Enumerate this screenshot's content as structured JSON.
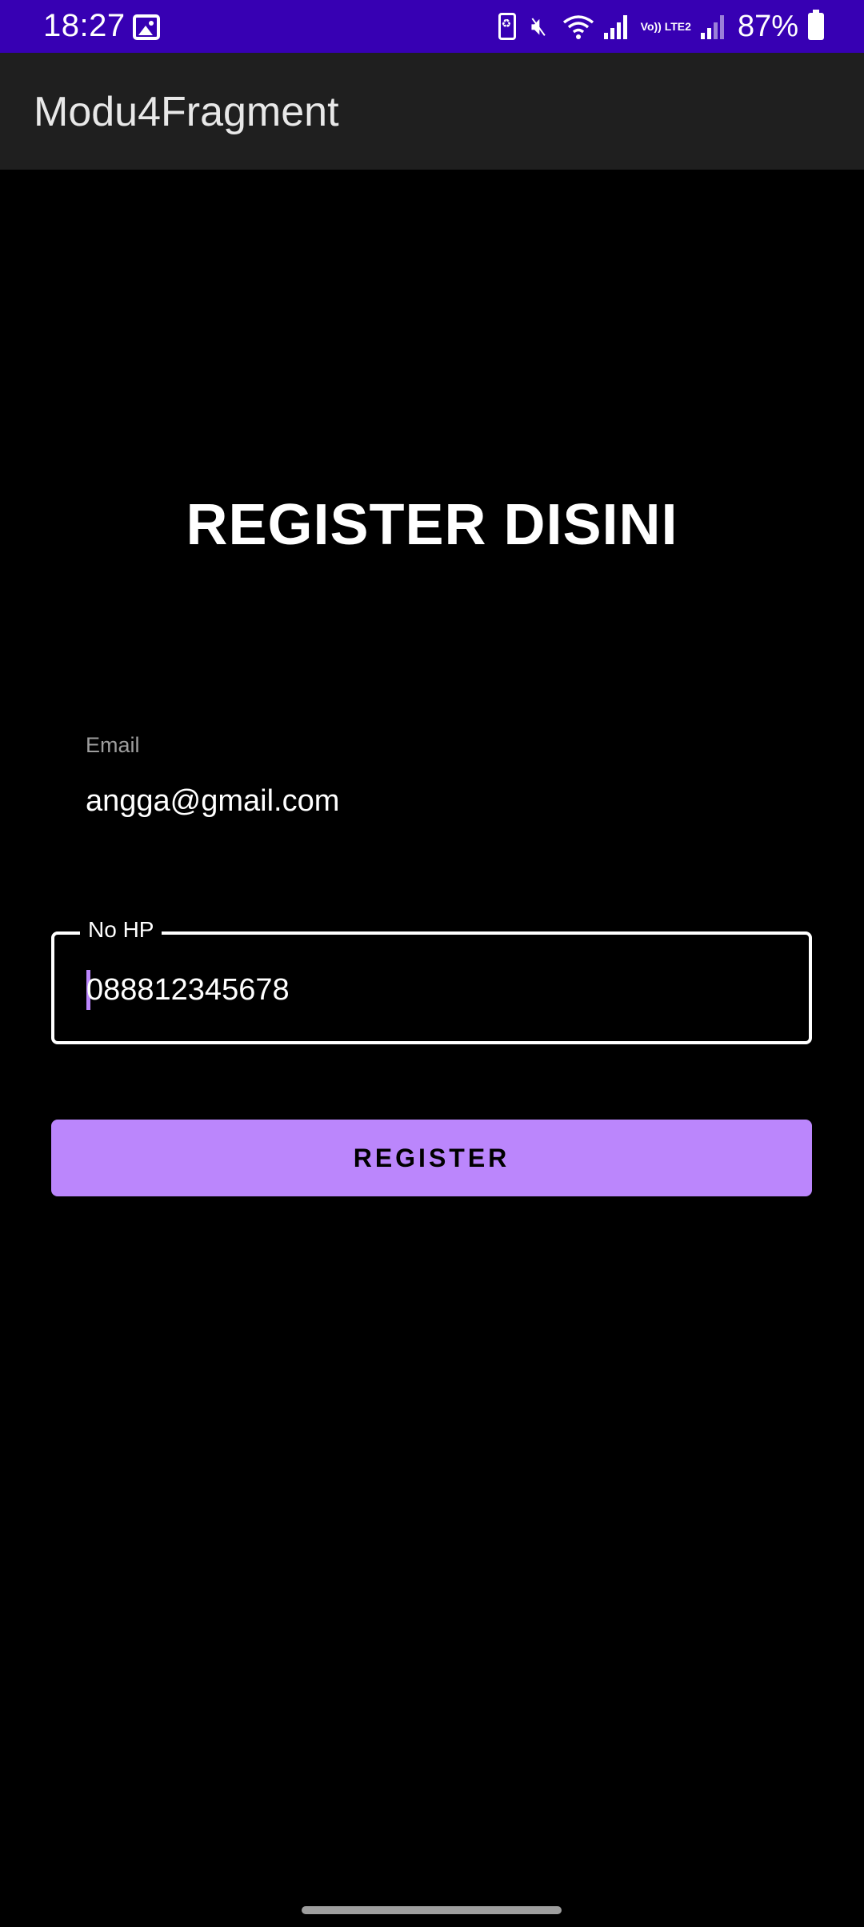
{
  "status_bar": {
    "time": "18:27",
    "battery_percent": "87%",
    "network_label": "Vo)) LTE2",
    "icons": [
      "gallery-icon",
      "battery-saver-icon",
      "mute-icon",
      "wifi-icon",
      "signal-icon",
      "battery-icon"
    ]
  },
  "app_bar": {
    "title": "Modu4Fragment"
  },
  "main": {
    "title": "REGISTER DISINI",
    "email": {
      "label": "Email",
      "value": "angga@gmail.com"
    },
    "phone": {
      "label": "No HP",
      "value": "088812345678"
    },
    "register_button_label": "REGISTER"
  },
  "colors": {
    "status_bar": "#3700b3",
    "app_bar": "#1f1f1f",
    "background": "#000000",
    "accent": "#bb86fc",
    "text_primary": "#ffffff",
    "text_hint": "#9e9e9e"
  }
}
